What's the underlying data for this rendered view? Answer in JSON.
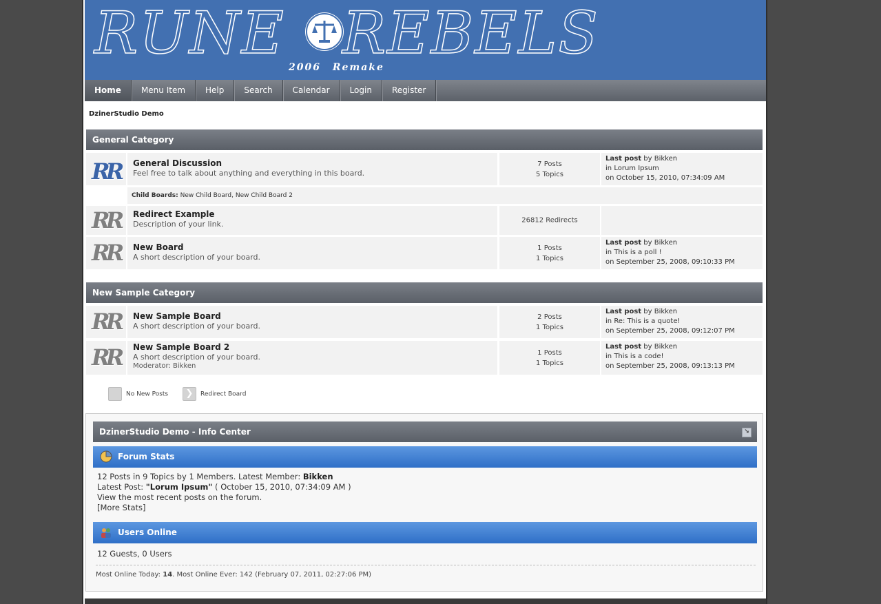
{
  "banner": {
    "logo_left": "RUNE",
    "logo_right": "REBELS",
    "subtitle": "2006 Remake",
    "seal_icon": "scales-icon",
    "color": "#4270b1"
  },
  "nav": {
    "items": [
      "Home",
      "Menu Item",
      "Help",
      "Search",
      "Calendar",
      "Login",
      "Register"
    ],
    "active": "Home"
  },
  "breadcrumb": "DzinerStudio Demo",
  "categories": [
    {
      "title": "General Category",
      "boards": [
        {
          "name": "General Discussion",
          "description": "Feel free to talk about anything and everything in this board.",
          "posts": "7 Posts",
          "topics": "5 Topics",
          "last_post_label": "Last post",
          "by": "by",
          "last_post_user": "Bikken",
          "in_label": "in",
          "last_post_topic": "Lorum Ipsum",
          "last_post_date": "on October 15, 2010, 07:34:09 AM",
          "child_boards_label": "Child Boards:",
          "child_boards": [
            "New Child Board",
            "New Child Board 2"
          ]
        },
        {
          "name": "Redirect Example",
          "description": "Description of your link.",
          "redirects": "26812 Redirects"
        },
        {
          "name": "New Board",
          "description": "A short description of your board.",
          "posts": "1 Posts",
          "topics": "1 Topics",
          "last_post_label": "Last post",
          "by": "by",
          "last_post_user": "Bikken",
          "in_label": "in",
          "last_post_topic": "This is a poll !",
          "last_post_date": "on September 25, 2008, 09:10:33 PM"
        }
      ]
    },
    {
      "title": "New Sample Category",
      "boards": [
        {
          "name": "New Sample Board",
          "description": "A short description of your board.",
          "posts": "2 Posts",
          "topics": "1 Topics",
          "last_post_label": "Last post",
          "by": "by",
          "last_post_user": "Bikken",
          "in_label": "in",
          "last_post_topic": "Re: This is a quote!",
          "last_post_date": "on September 25, 2008, 09:12:07 PM"
        },
        {
          "name": "New Sample Board 2",
          "description": "A short description of your board.",
          "moderator_label": "Moderator:",
          "moderator": "Bikken",
          "posts": "1 Posts",
          "topics": "1 Topics",
          "last_post_label": "Last post",
          "by": "by",
          "last_post_user": "Bikken",
          "in_label": "in",
          "last_post_topic": "This is a code!",
          "last_post_date": "on September 25, 2008, 09:13:13 PM"
        }
      ]
    }
  ],
  "legend": {
    "no_new_posts": "No New Posts",
    "redirect_board": "Redirect Board"
  },
  "info_center": {
    "title": "DzinerStudio Demo - Info Center",
    "forum_stats": {
      "title": "Forum Stats",
      "line1_prefix": "12 Posts in 9 Topics by 1 Members. Latest Member: ",
      "latest_member": "Bikken",
      "line2_prefix": "Latest Post: ",
      "latest_post": "\"Lorum Ipsum\"",
      "line2_suffix": " ( October 15, 2010, 07:34:09 AM )",
      "line3": "View the most recent posts on the forum.",
      "more_stats": "[More Stats]"
    },
    "users_online": {
      "title": "Users Online",
      "summary": "12 Guests, 0 Users",
      "most_today_label": "Most Online Today: ",
      "most_today": "14",
      "most_ever": ". Most Online Ever: 142 (February 07, 2011, 02:27:06 PM)"
    }
  },
  "colors": {
    "header_gray": "#5a5f67",
    "info_blue": "#2f6fc7",
    "cell_bg": "#f2f2f2"
  }
}
